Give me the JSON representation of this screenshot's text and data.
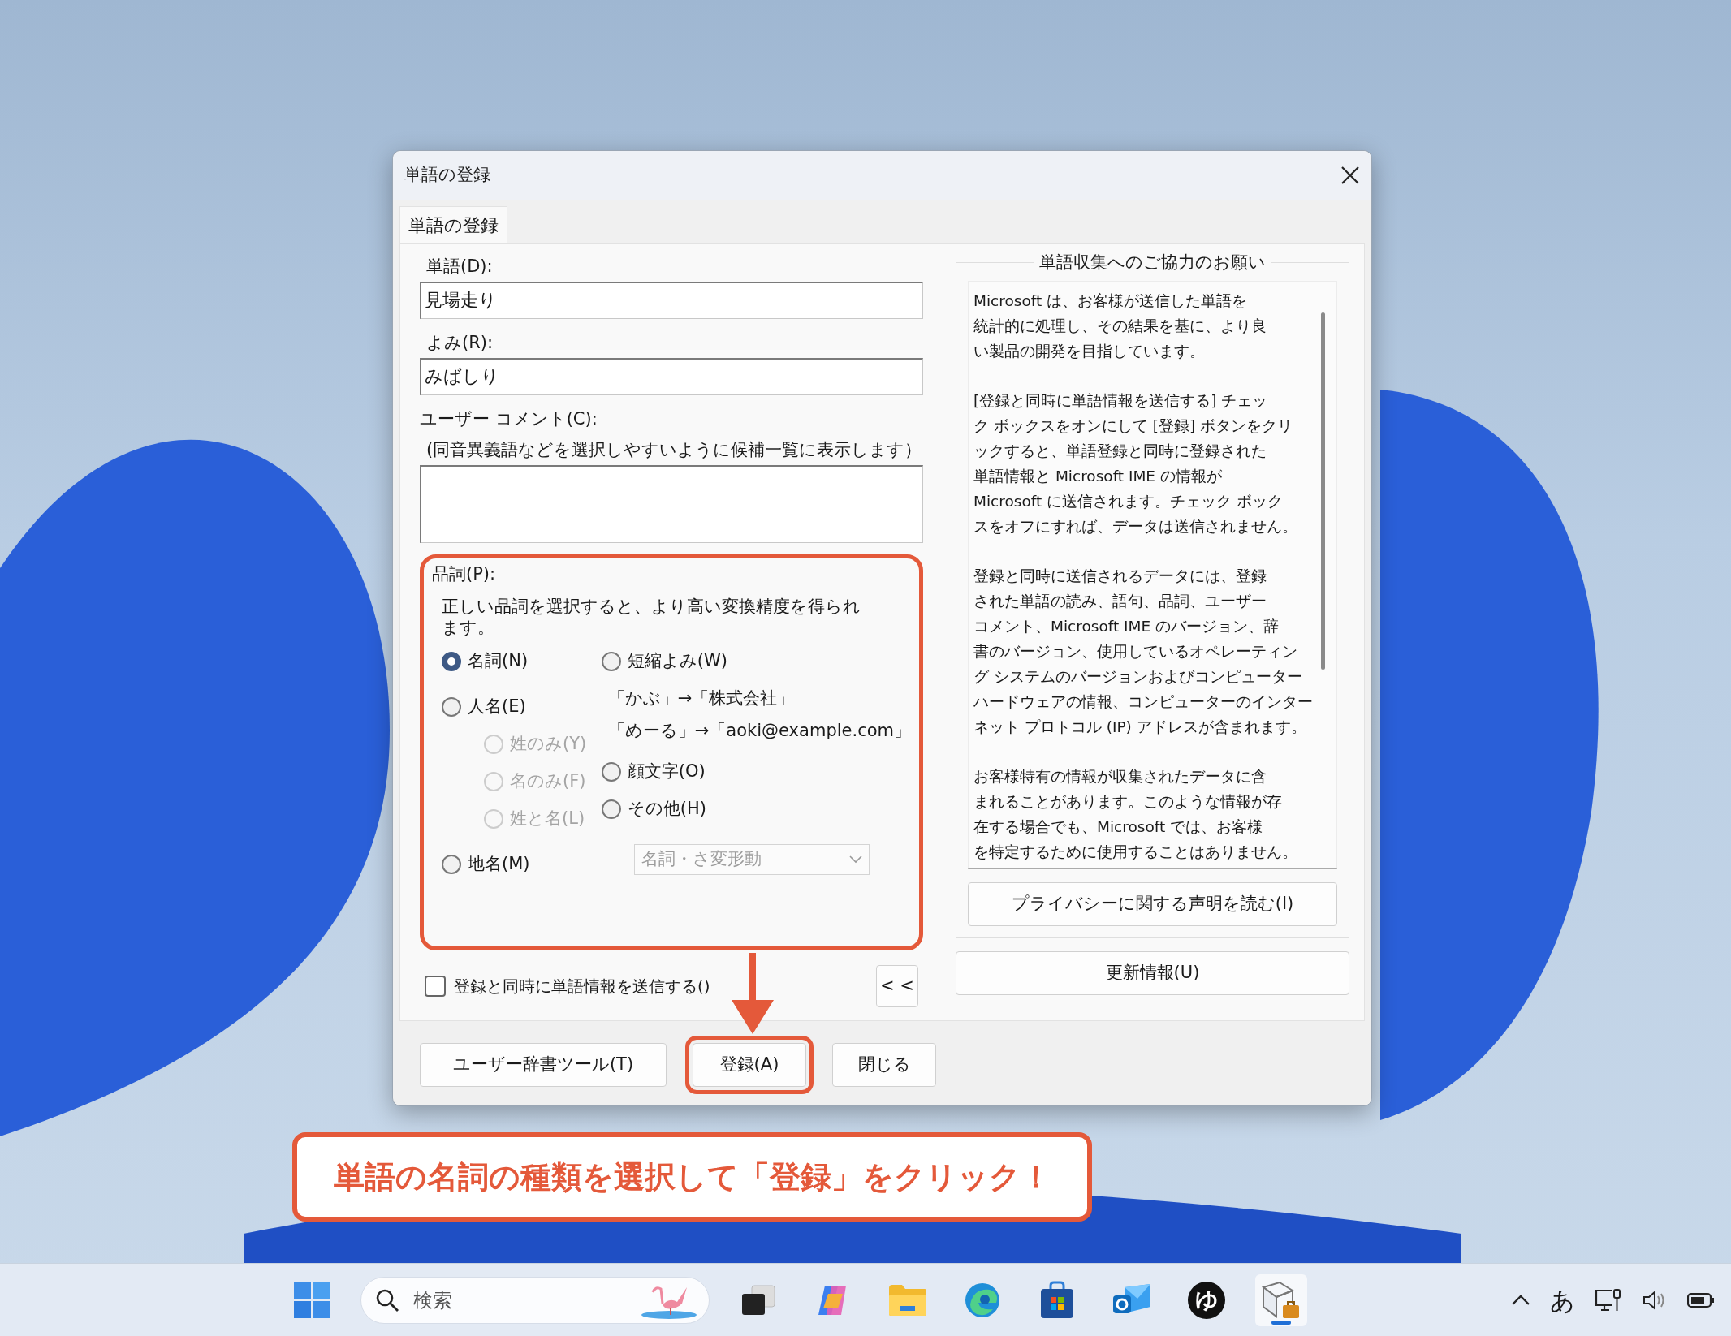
{
  "window": {
    "title": "単語の登録"
  },
  "tabs": [
    {
      "label": "単語の登録",
      "selected": true
    }
  ],
  "word": {
    "label": "単語(D):",
    "value": "見場走り"
  },
  "reading": {
    "label": "よみ(R):",
    "value": "みばしり"
  },
  "comment": {
    "label": "ユーザー コメント(C):",
    "hint": "(同音異義語などを選択しやすいように候補一覧に表示します）"
  },
  "part_of_speech": {
    "label": "品詞(P):",
    "description": "正しい品詞を選択すると、より高い変換精度を得られます。",
    "highlighted": true,
    "left_options": [
      {
        "label": "名詞(N)",
        "selected": true,
        "disabled": false
      },
      {
        "label": "人名(E)",
        "selected": false,
        "disabled": false,
        "children": [
          {
            "label": "姓のみ(Y)",
            "selected": false,
            "disabled": true
          },
          {
            "label": "名のみ(F)",
            "selected": false,
            "disabled": true
          },
          {
            "label": "姓と名(L)",
            "selected": false,
            "disabled": true
          }
        ]
      },
      {
        "label": "地名(M)",
        "selected": false,
        "disabled": false
      }
    ],
    "right_options": [
      {
        "label": "短縮よみ(W)",
        "selected": false,
        "disabled": false,
        "examples": [
          "「かぶ」→「株式会社」",
          "「めーる」→「aoki@example.com」"
        ]
      },
      {
        "label": "顔文字(O)",
        "selected": false,
        "disabled": false
      },
      {
        "label": "その他(H)",
        "selected": false,
        "disabled": false
      }
    ],
    "dropdown": {
      "value": "名詞・さ変形動",
      "disabled": true
    }
  },
  "send_checkbox": {
    "label": "登録と同時に単語情報を送信する()",
    "checked": false
  },
  "collapse_button": {
    "label": "< <"
  },
  "info": {
    "title": "単語収集へのご協力のお願い",
    "paragraphs": [
      [
        "Microsoft は、お客様が送信した単語を",
        "統計的に処理し、その結果を基に、より良",
        "い製品の開発を目指しています。"
      ],
      [
        "[登録と同時に単語情報を送信する] チェッ",
        "ク ボックスをオンにして [登録] ボタンをクリ",
        "ックすると、単語登録と同時に登録された",
        "単語情報と Microsoft IME の情報が",
        "Microsoft に送信されます。チェック ボック",
        "スをオフにすれば、データは送信されません。"
      ],
      [
        "登録と同時に送信されるデータには、登録",
        "された単語の読み、語句、品詞、ユーザー",
        "コメント、Microsoft IME のバージョン、辞",
        "書のバージョン、使用しているオペレーティン",
        "グ システムのバージョンおよびコンピューター",
        "ハードウェアの情報、コンピューターのインター",
        "ネット プロトコル (IP) アドレスが含まれます。"
      ],
      [
        "お客様特有の情報が収集されたデータに含",
        "まれることがあります。このような情報が存",
        "在する場合でも、Microsoft では、お客様",
        "を特定するために使用することはありません。"
      ]
    ],
    "privacy_button": "プライバシーに関する声明を読む(I)"
  },
  "update_button": "更新情報(U)",
  "buttons": [
    {
      "label": "ユーザー辞書ツール(T)",
      "highlighted": false
    },
    {
      "label": "登録(A)",
      "highlighted": true
    },
    {
      "label": "閉じる",
      "highlighted": false
    }
  ],
  "callout": "単語の名詞の種類を選択して「登録」をクリック！",
  "taskbar": {
    "search_placeholder": "検索",
    "apps": [
      {
        "kind": "taskview",
        "selected": false
      },
      {
        "kind": "copilot",
        "selected": false
      },
      {
        "kind": "folder",
        "selected": false
      },
      {
        "kind": "browser",
        "selected": false
      },
      {
        "kind": "store",
        "selected": false
      },
      {
        "kind": "mail",
        "selected": false
      },
      {
        "kind": "ime",
        "label": "ゆ",
        "selected": false
      },
      {
        "kind": "dictionary",
        "selected": true
      }
    ],
    "ime_indicator": "あ"
  }
}
